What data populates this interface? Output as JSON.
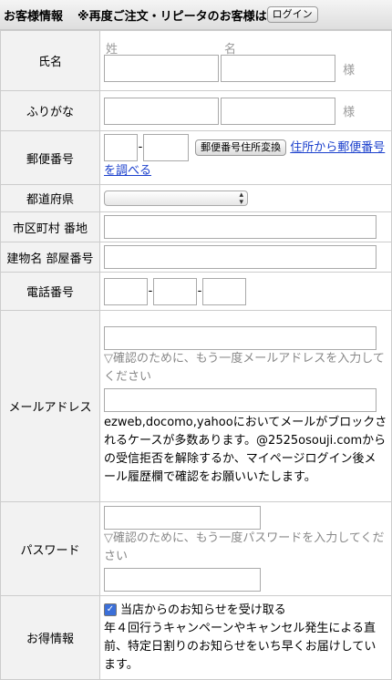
{
  "header": {
    "title": "お客様情報",
    "repeat_note": "※再度ご注文・リピータのお客様は",
    "login_button": "ログイン"
  },
  "rows": {
    "name": {
      "label": "氏名",
      "sei_caption": "姓",
      "mei_caption": "名",
      "suffix": "様"
    },
    "furigana": {
      "label": "ふりがな",
      "suffix": "様"
    },
    "postal": {
      "label": "郵便番号",
      "convert_button": "郵便番号住所変換",
      "lookup_link": "住所から郵便番号を調べる"
    },
    "prefecture": {
      "label": "都道府県",
      "selected": ""
    },
    "city": {
      "label": "市区町村 番地"
    },
    "building": {
      "label": "建物名 部屋番号"
    },
    "phone": {
      "label": "電話番号"
    },
    "email": {
      "label": "メールアドレス",
      "confirm_note": "▽確認のために、もう一度メールアドレスを入力してください",
      "warning": "ezweb,docomo,yahooにおいてメールがブロックされるケースが多数あります。@2525osouji.comからの受信拒否を解除するか、マイページログイン後メール履歴欄で確認をお願いいたします。"
    },
    "password": {
      "label": "パスワード",
      "confirm_note": "▽確認のために、もう一度パスワードを入力してください"
    },
    "benefits": {
      "label": "お得情報",
      "checkbox_label": "当店からのお知らせを受け取る",
      "checked": true,
      "description": "年４回行うキャンペーンやキャンセル発生による直前、特定日割りのお知らせをいち早くお届けしています。"
    }
  }
}
